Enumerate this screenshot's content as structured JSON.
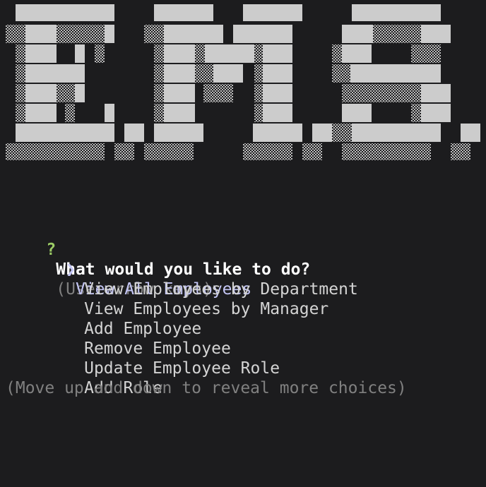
{
  "colors": {
    "background": "#1c1c1e",
    "block": "#cccccc",
    "question_mark": "#9ccc65",
    "selected": "#c4c6f5",
    "hint": "#808080",
    "text": "#d4d4d4"
  },
  "banner": {
    "text": "E.M.S."
  },
  "prompt": {
    "qmark": "?",
    "question": "What would you like to do?",
    "hint": "(Use arrow keys)",
    "pointer": "❯",
    "choices": [
      "View All Employees",
      "View Employees by Department",
      "View Employees by Manager",
      "Add Employee",
      "Remove Employee",
      "Update Employee Role",
      "Add Role"
    ],
    "selected_index": 0,
    "footer": "(Move up and down to reveal more choices)"
  }
}
